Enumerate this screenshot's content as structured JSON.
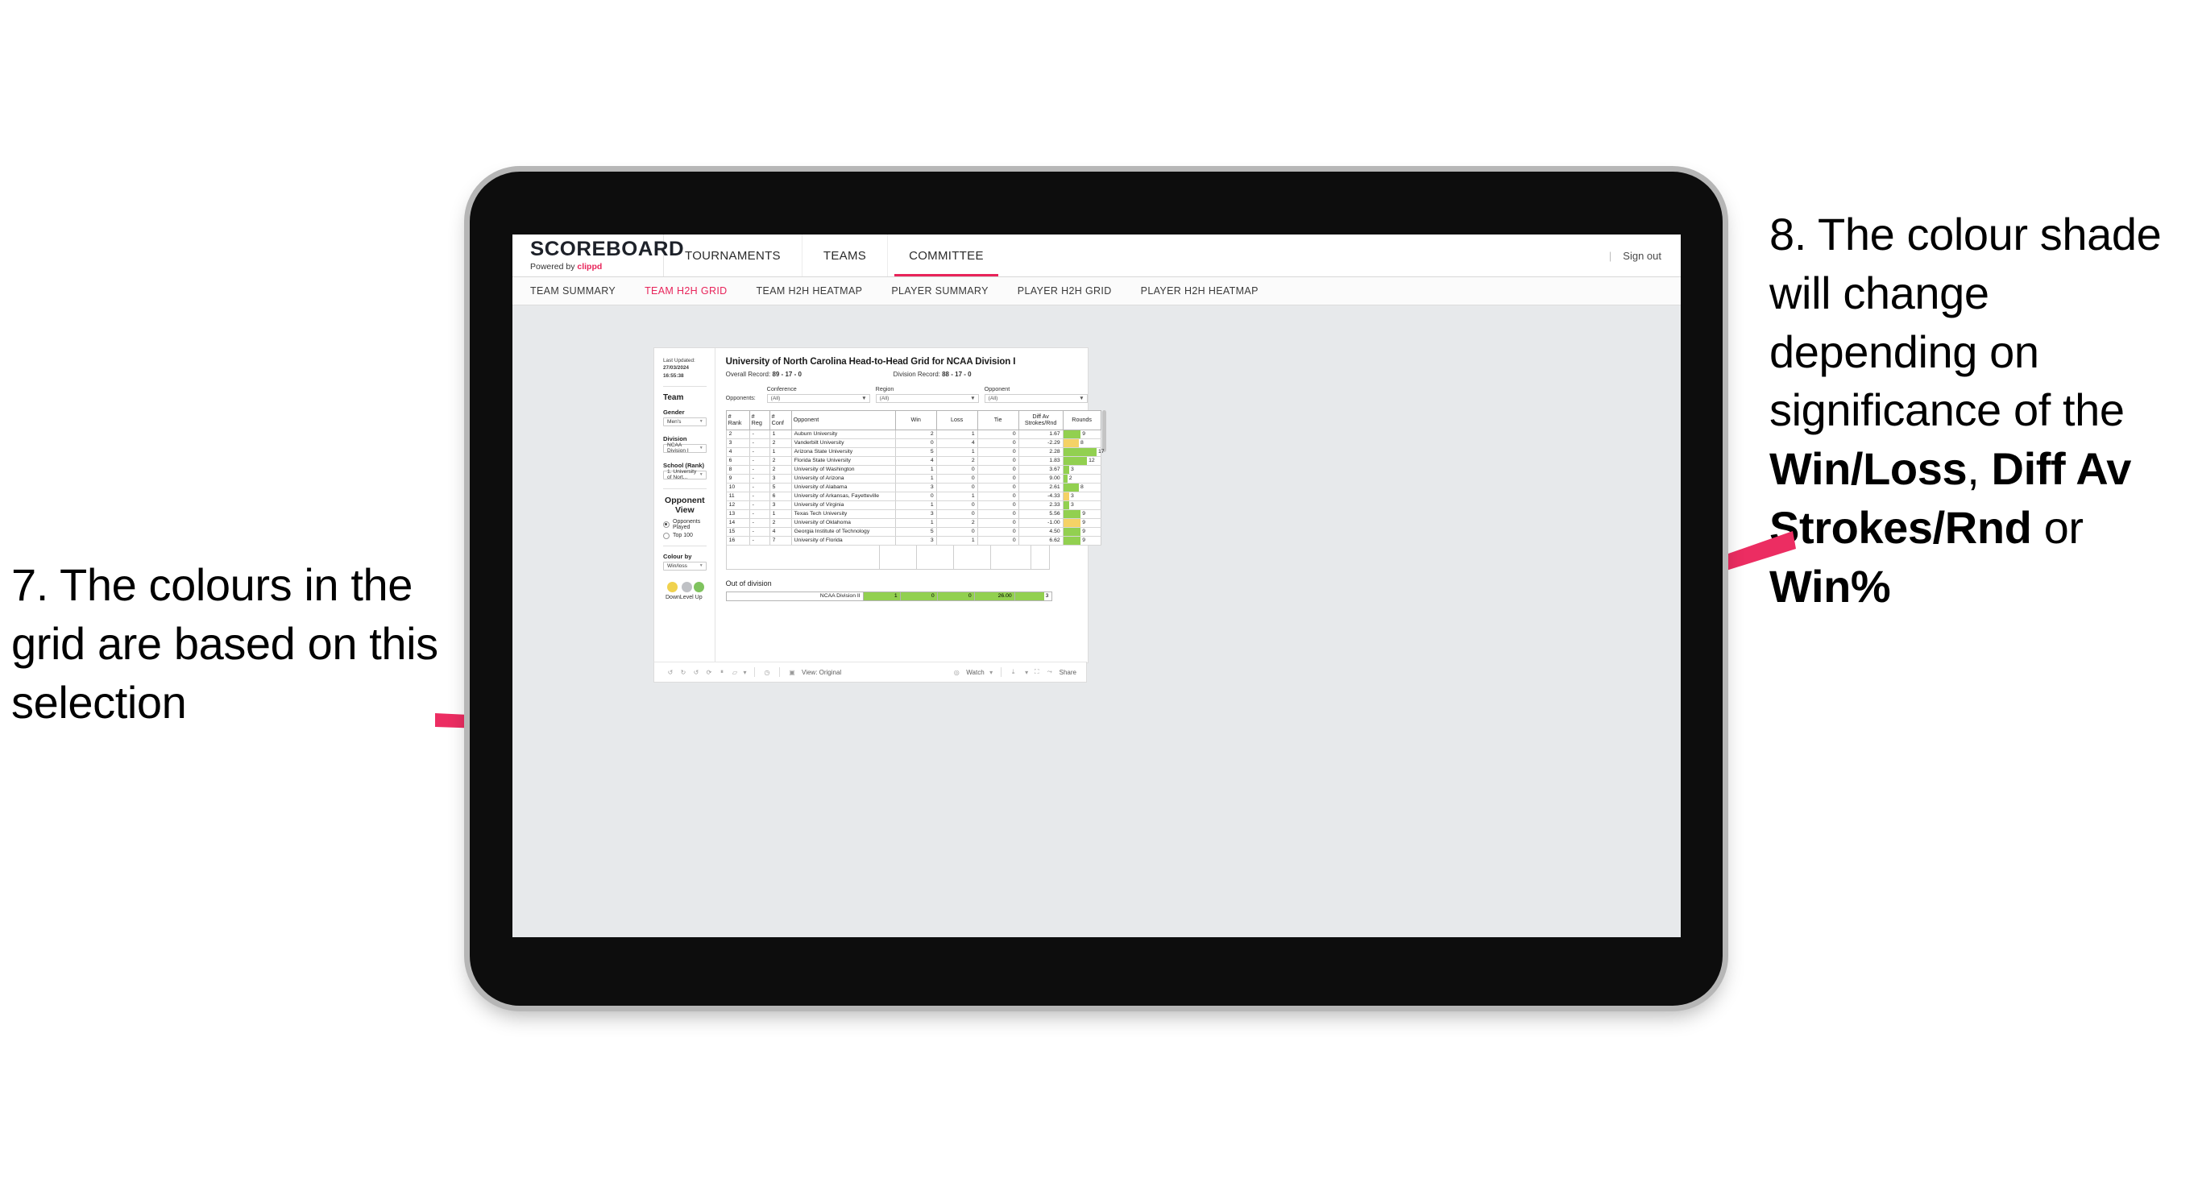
{
  "annotations": {
    "left": "7. The colours in the grid are based on this selection",
    "right_pre": "8. The colour shade will change depending on significance of the ",
    "right_b1": "Win/Loss",
    "right_mid1": ", ",
    "right_b2": "Diff Av Strokes/Rnd",
    "right_mid2": " or ",
    "right_b3": "Win%",
    "arrow_color": "#ec2d62"
  },
  "header": {
    "brand_title": "SCOREBOARD",
    "brand_powered": "Powered by ",
    "brand_name": "clippd",
    "nav": [
      {
        "label": "TOURNAMENTS",
        "active": false
      },
      {
        "label": "TEAMS",
        "active": false
      },
      {
        "label": "COMMITTEE",
        "active": true
      }
    ],
    "divider": "|",
    "sign_out": "Sign out"
  },
  "subnav": [
    {
      "label": "TEAM SUMMARY",
      "active": false
    },
    {
      "label": "TEAM H2H GRID",
      "active": true
    },
    {
      "label": "TEAM H2H HEATMAP",
      "active": false
    },
    {
      "label": "PLAYER SUMMARY",
      "active": false
    },
    {
      "label": "PLAYER H2H GRID",
      "active": false
    },
    {
      "label": "PLAYER H2H HEATMAP",
      "active": false
    }
  ],
  "sidebar": {
    "last_updated_label": "Last Updated: ",
    "last_updated_value": "27/03/2024 16:55:38",
    "team_title": "Team",
    "gender_label": "Gender",
    "gender_value": "Men's",
    "division_label": "Division",
    "division_value": "NCAA Division I",
    "school_label": "School (Rank)",
    "school_value": "1. University of Nort...",
    "opponent_view_title": "Opponent View",
    "opponent_view_options": [
      {
        "label": "Opponents Played",
        "selected": true
      },
      {
        "label": "Top 100",
        "selected": false
      }
    ],
    "colour_by_label": "Colour by",
    "colour_by_value": "Win/loss",
    "legend": [
      {
        "label": "Down",
        "color": "#f0d24e"
      },
      {
        "label": "Level",
        "color": "#bfc1c5"
      },
      {
        "label": "Up",
        "color": "#7fc35e"
      }
    ]
  },
  "main": {
    "title": "University of North Carolina Head-to-Head Grid for NCAA Division I",
    "overall_record_label": "Overall Record: ",
    "overall_record_value": "89 - 17 - 0",
    "division_record_label": "Division Record: ",
    "division_record_value": "88 - 17 - 0",
    "opponents_label": "Opponents:",
    "filters": [
      {
        "name": "Conference",
        "value": "(All)"
      },
      {
        "name": "Region",
        "value": "(All)"
      },
      {
        "name": "Opponent",
        "value": "(All)"
      }
    ],
    "table_headers": [
      "# Rank",
      "# Reg",
      "# Conf",
      "Opponent",
      "Win",
      "Loss",
      "Tie",
      "Diff Av Strokes/Rnd",
      "Rounds"
    ],
    "header_lines": {
      "rank": [
        "#",
        "Rank"
      ],
      "reg": [
        "#",
        "Reg"
      ],
      "conf": [
        "#",
        "Conf"
      ],
      "opponent": [
        "Opponent"
      ],
      "win": [
        "Win"
      ],
      "loss": [
        "Loss"
      ],
      "tie": [
        "Tie"
      ],
      "diff": [
        "Diff Av",
        "Strokes/Rnd"
      ],
      "rounds": [
        "Rounds"
      ]
    },
    "rows": [
      {
        "rank": "2",
        "reg": "-",
        "conf": "1",
        "opponent": "Auburn University",
        "win": "2",
        "loss": "1",
        "tie": "0",
        "diff": "1.67",
        "rounds": "9",
        "tone": "green",
        "bar_pct": 47
      },
      {
        "rank": "3",
        "reg": "-",
        "conf": "2",
        "opponent": "Vanderbilt University",
        "win": "0",
        "loss": "4",
        "tie": "0",
        "diff": "-2.29",
        "rounds": "8",
        "tone": "yellow",
        "bar_pct": 42
      },
      {
        "rank": "4",
        "reg": "-",
        "conf": "1",
        "opponent": "Arizona State University",
        "win": "5",
        "loss": "1",
        "tie": "0",
        "diff": "2.28",
        "rounds": "17",
        "tone": "green",
        "bar_pct": 90
      },
      {
        "rank": "6",
        "reg": "-",
        "conf": "2",
        "opponent": "Florida State University",
        "win": "4",
        "loss": "2",
        "tie": "0",
        "diff": "1.83",
        "rounds": "12",
        "tone": "green",
        "bar_pct": 64
      },
      {
        "rank": "8",
        "reg": "-",
        "conf": "2",
        "opponent": "University of Washington",
        "win": "1",
        "loss": "0",
        "tie": "0",
        "diff": "3.67",
        "rounds": "3",
        "tone": "green",
        "bar_pct": 16
      },
      {
        "rank": "9",
        "reg": "-",
        "conf": "3",
        "opponent": "University of Arizona",
        "win": "1",
        "loss": "0",
        "tie": "0",
        "diff": "9.00",
        "rounds": "2",
        "tone": "green",
        "bar_pct": 11
      },
      {
        "rank": "10",
        "reg": "-",
        "conf": "5",
        "opponent": "University of Alabama",
        "win": "3",
        "loss": "0",
        "tie": "0",
        "diff": "2.61",
        "rounds": "8",
        "tone": "green",
        "bar_pct": 42
      },
      {
        "rank": "11",
        "reg": "-",
        "conf": "6",
        "opponent": "University of Arkansas, Fayetteville",
        "win": "0",
        "loss": "1",
        "tie": "0",
        "diff": "-4.33",
        "rounds": "3",
        "tone": "yellow",
        "bar_pct": 16
      },
      {
        "rank": "12",
        "reg": "-",
        "conf": "3",
        "opponent": "University of Virginia",
        "win": "1",
        "loss": "0",
        "tie": "0",
        "diff": "2.33",
        "rounds": "3",
        "tone": "green",
        "bar_pct": 16
      },
      {
        "rank": "13",
        "reg": "-",
        "conf": "1",
        "opponent": "Texas Tech University",
        "win": "3",
        "loss": "0",
        "tie": "0",
        "diff": "5.56",
        "rounds": "9",
        "tone": "green",
        "bar_pct": 47
      },
      {
        "rank": "14",
        "reg": "-",
        "conf": "2",
        "opponent": "University of Oklahoma",
        "win": "1",
        "loss": "2",
        "tie": "0",
        "diff": "-1.00",
        "rounds": "9",
        "tone": "yellow",
        "bar_pct": 47
      },
      {
        "rank": "15",
        "reg": "-",
        "conf": "4",
        "opponent": "Georgia Institute of Technology",
        "win": "5",
        "loss": "0",
        "tie": "0",
        "diff": "4.50",
        "rounds": "9",
        "tone": "green",
        "bar_pct": 47
      },
      {
        "rank": "16",
        "reg": "-",
        "conf": "7",
        "opponent": "University of Florida",
        "win": "3",
        "loss": "1",
        "tie": "0",
        "diff": "6.62",
        "rounds": "9",
        "tone": "green",
        "bar_pct": 47
      }
    ],
    "out_of_division_title": "Out of division",
    "out_of_division_row": {
      "name": "NCAA Division II",
      "win": "1",
      "loss": "0",
      "tie": "0",
      "diff": "26.00",
      "rounds": "3",
      "tone": "green",
      "bar_pct": 80
    }
  },
  "toolbar": {
    "icons": [
      "undo-icon",
      "redo-icon",
      "revert-icon",
      "refresh-icon",
      "pause-icon",
      "highlight-icon"
    ],
    "view_label": "View: Original",
    "watch_label": "Watch",
    "share_label": "Share"
  }
}
